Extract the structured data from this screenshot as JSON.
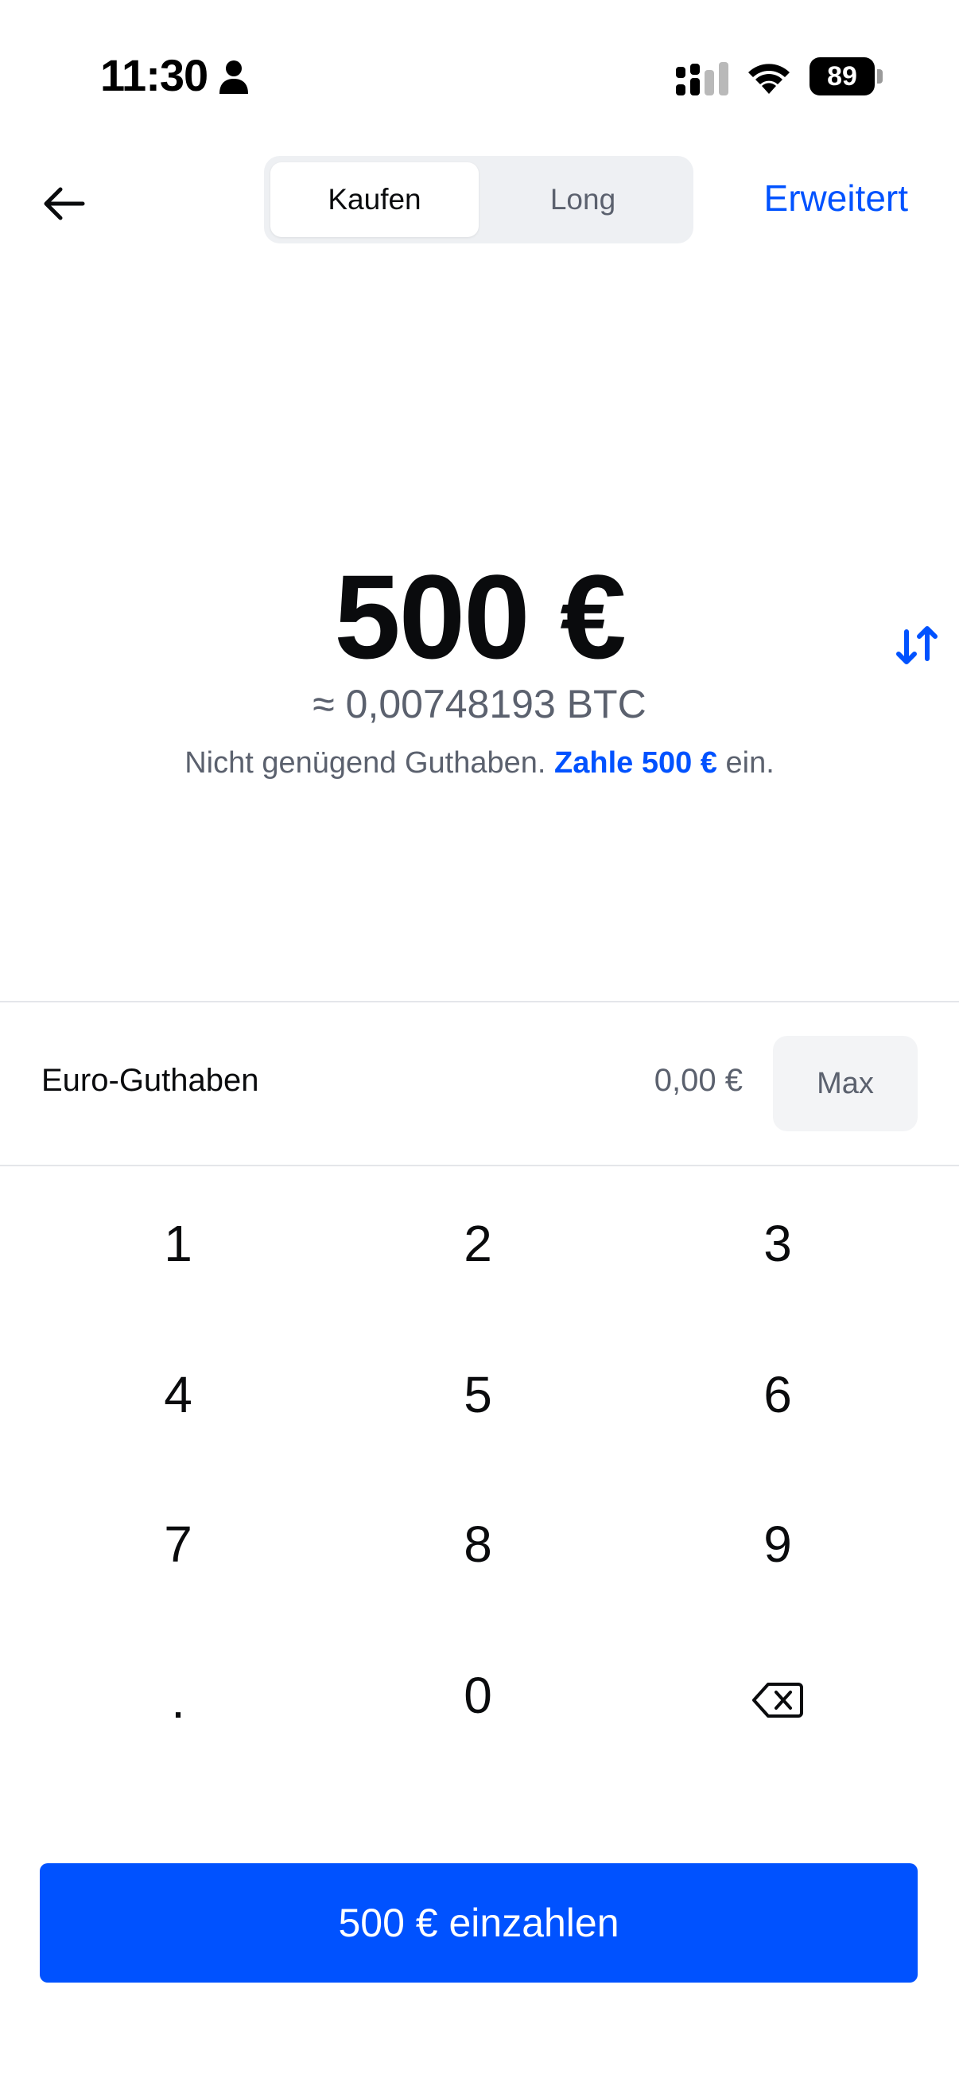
{
  "status_bar": {
    "time": "11:30",
    "battery_level": "89",
    "icons": [
      "person-icon",
      "signal-icon",
      "wifi-icon",
      "battery-icon"
    ]
  },
  "header": {
    "back_icon": "arrow-left-icon",
    "tabs": [
      {
        "label": "Kaufen",
        "active": true
      },
      {
        "label": "Long",
        "active": false
      }
    ],
    "advanced_label": "Erweitert"
  },
  "amount": {
    "fiat": "500 €",
    "crypto_equivalent": "≈ 0,00748193 BTC",
    "swap_icon": "swap-vertical-icon",
    "warning_prefix": "Nicht genügend Guthaben.",
    "warning_link": "Zahle 500 €",
    "warning_suffix": "ein."
  },
  "balance": {
    "label": "Euro-Guthaben",
    "value": "0,00 €",
    "max_label": "Max"
  },
  "keypad": {
    "keys": [
      "1",
      "2",
      "3",
      "4",
      "5",
      "6",
      "7",
      "8",
      "9",
      ".",
      "0"
    ],
    "backspace_icon": "backspace-icon"
  },
  "deposit_button": {
    "label": "500 € einzahlen"
  },
  "colors": {
    "accent": "#0052ff",
    "text_primary": "#0a0b0d",
    "text_secondary": "#5b616e",
    "segment_bg": "#eef0f3",
    "max_bg": "#f3f4f6",
    "divider": "#e4e6ea"
  }
}
